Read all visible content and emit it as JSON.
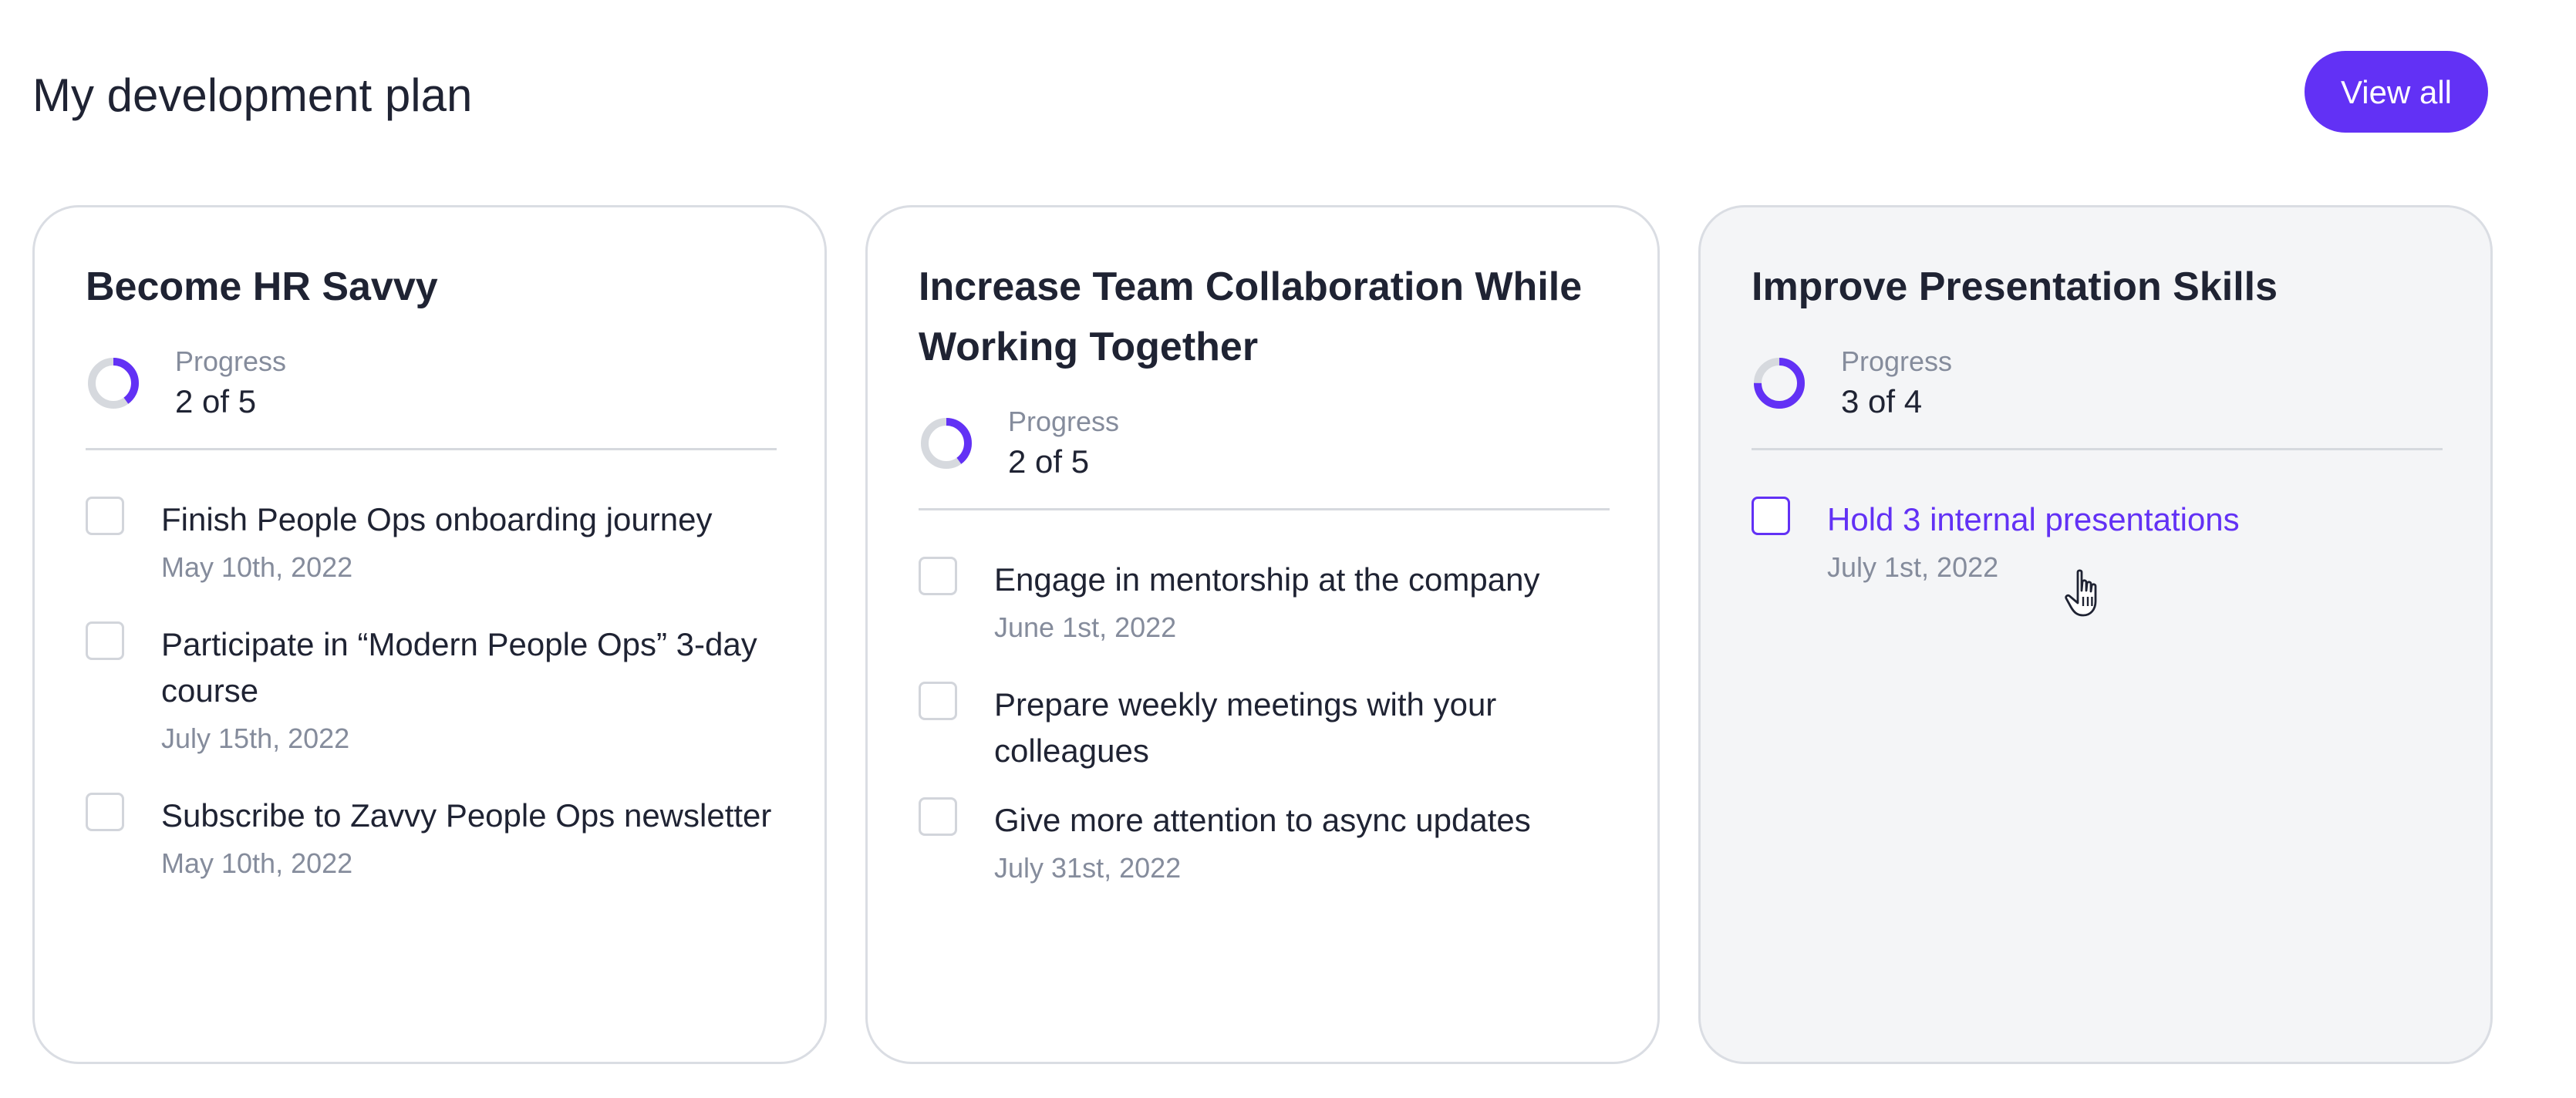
{
  "header": {
    "title": "My development plan",
    "view_all_label": "View all"
  },
  "colors": {
    "accent": "#6231f5",
    "ring_track": "#d6d9de",
    "muted_text": "#858c9c",
    "body_text": "#1f2333"
  },
  "cards": [
    {
      "title": "Become HR Savvy",
      "progress_label": "Progress",
      "progress_value": "2 of 5",
      "progress_fraction": 0.4,
      "tasks": [
        {
          "title": "Finish People Ops onboarding journey",
          "date": "May 10th, 2022"
        },
        {
          "title": "Participate in “Modern People Ops” 3-day course",
          "date": "July 15th, 2022"
        },
        {
          "title": "Subscribe to Zavvy People Ops newsletter",
          "date": "May 10th, 2022"
        }
      ]
    },
    {
      "title": "Increase Team Collaboration While Working Together",
      "progress_label": "Progress",
      "progress_value": "2 of 5",
      "progress_fraction": 0.4,
      "tasks": [
        {
          "title": "Engage in mentorship at the company",
          "date": "June 1st, 2022"
        },
        {
          "title": "Prepare weekly meetings with your colleagues",
          "date": ""
        },
        {
          "title": "Give more attention to async updates",
          "date": "July 31st, 2022"
        }
      ]
    },
    {
      "title": "Improve Presentation Skills",
      "progress_label": "Progress",
      "progress_value": "3 of 4",
      "progress_fraction": 0.75,
      "highlighted": true,
      "tasks": [
        {
          "title": "Hold 3 internal presentations",
          "date": "July 1st, 2022",
          "hovered": true
        }
      ]
    }
  ]
}
